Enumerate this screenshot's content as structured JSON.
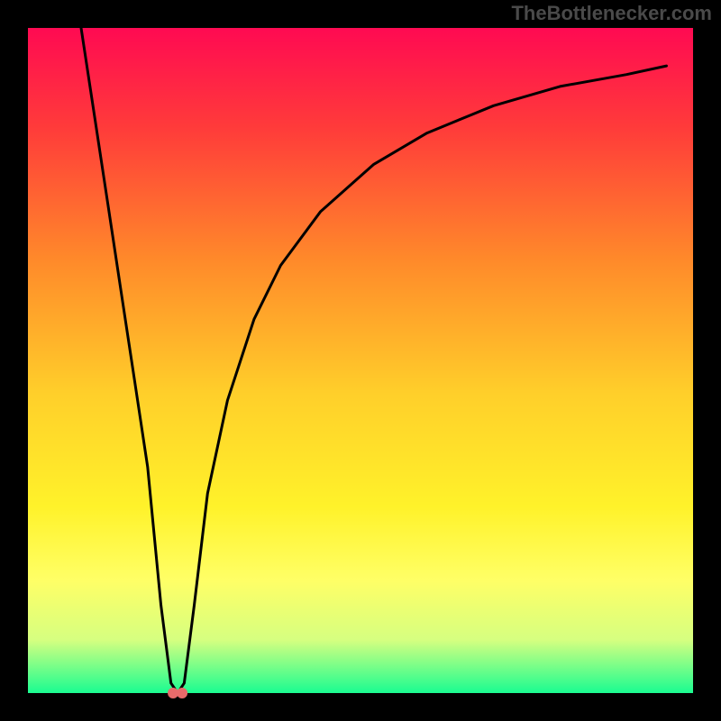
{
  "attribution": "TheBottlenecker.com",
  "chart_data": {
    "type": "line",
    "xlim": [
      0,
      100
    ],
    "ylim": [
      0,
      100
    ],
    "minimum_x": 22.5,
    "curve_points": [
      [
        8.0,
        100.0
      ],
      [
        10.0,
        86.8
      ],
      [
        12.0,
        73.6
      ],
      [
        14.0,
        60.4
      ],
      [
        16.0,
        47.2
      ],
      [
        18.0,
        34.0
      ],
      [
        20.0,
        13.2
      ],
      [
        21.5,
        1.5
      ],
      [
        22.5,
        0.0
      ],
      [
        23.5,
        1.5
      ],
      [
        25.0,
        13.2
      ],
      [
        27.0,
        30.0
      ],
      [
        30.0,
        44.0
      ],
      [
        34.0,
        56.2
      ],
      [
        38.0,
        64.3
      ],
      [
        44.0,
        72.4
      ],
      [
        52.0,
        79.5
      ],
      [
        60.0,
        84.2
      ],
      [
        70.0,
        88.3
      ],
      [
        80.0,
        91.2
      ],
      [
        90.0,
        93.0
      ],
      [
        96.0,
        94.3
      ]
    ],
    "minimum_marker": {
      "x_pct": 22.5,
      "y_pct": 0.0,
      "radius": 6
    },
    "gradient_stops": [
      {
        "offset": 0,
        "color": "#ff0a52"
      },
      {
        "offset": 15,
        "color": "#ff3b3a"
      },
      {
        "offset": 35,
        "color": "#ff8a2a"
      },
      {
        "offset": 55,
        "color": "#ffcf2a"
      },
      {
        "offset": 72,
        "color": "#fff22a"
      },
      {
        "offset": 83,
        "color": "#ffff66"
      },
      {
        "offset": 92,
        "color": "#d6ff80"
      },
      {
        "offset": 100,
        "color": "#1afc91"
      }
    ]
  }
}
